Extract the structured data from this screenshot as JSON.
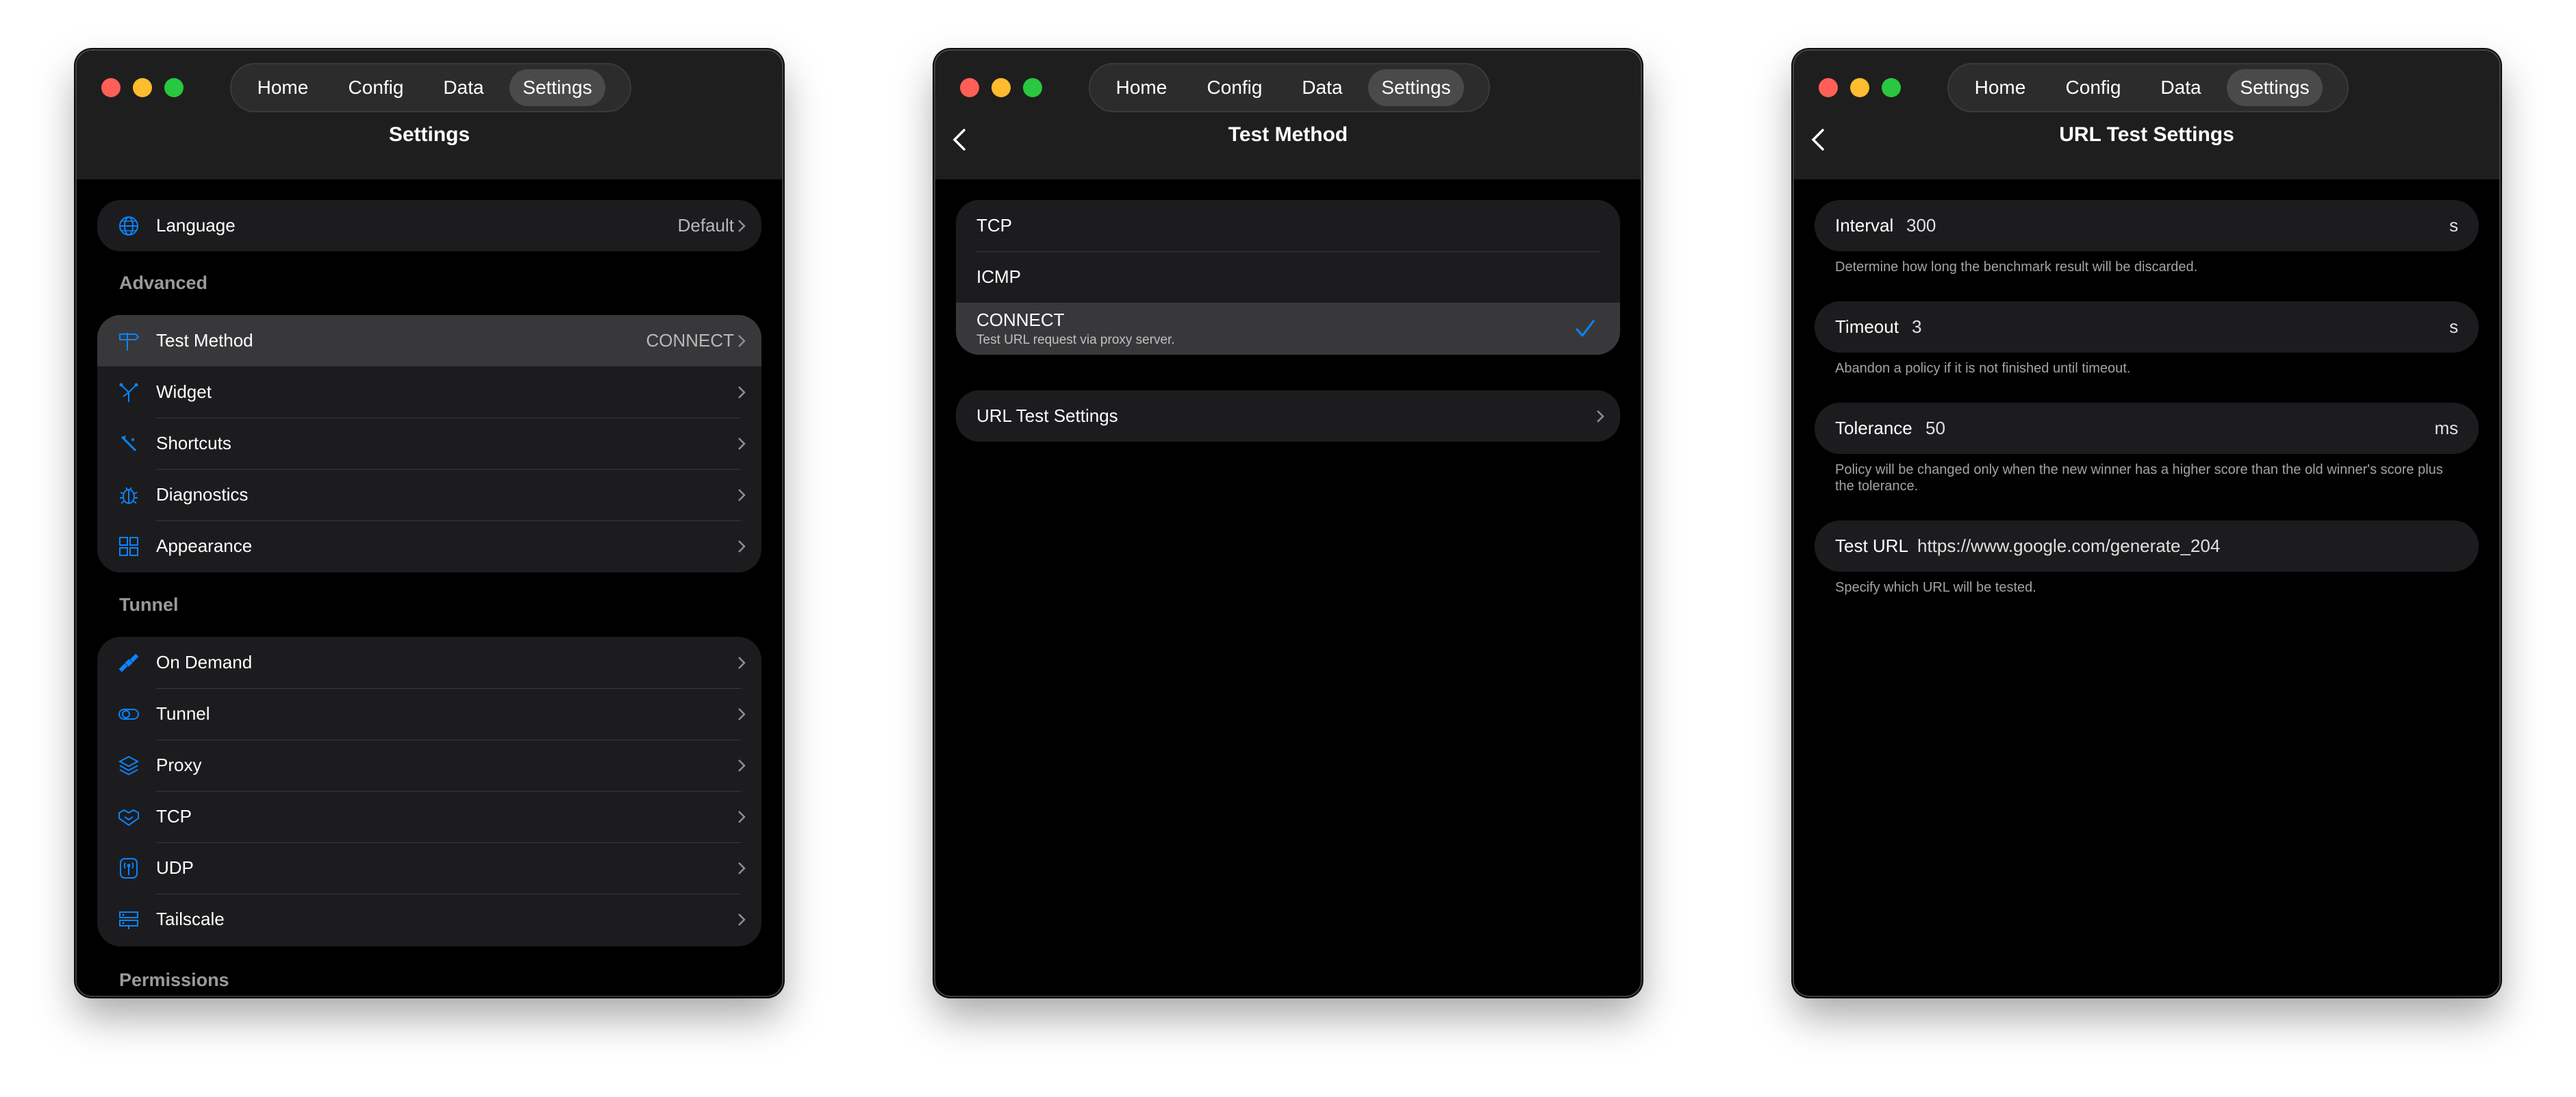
{
  "nav_tabs": [
    "Home",
    "Config",
    "Data",
    "Settings"
  ],
  "colors": {
    "accent": "#0a84ff",
    "row_bg": "#1c1c1e",
    "highlight": "#38383a"
  },
  "window1": {
    "title": "Settings",
    "language": {
      "label": "Language",
      "value": "Default"
    },
    "advanced_header": "Advanced",
    "advanced_items": [
      {
        "label": "Test Method",
        "value": "CONNECT",
        "icon": "signpost-icon"
      },
      {
        "label": "Widget",
        "value": "",
        "icon": "widget-icon"
      },
      {
        "label": "Shortcuts",
        "value": "",
        "icon": "shortcuts-icon"
      },
      {
        "label": "Diagnostics",
        "value": "",
        "icon": "ladybug-icon"
      },
      {
        "label": "Appearance",
        "value": "",
        "icon": "grid-icon"
      }
    ],
    "tunnel_header": "Tunnel",
    "tunnel_items": [
      {
        "label": "On Demand",
        "icon": "satellite-icon"
      },
      {
        "label": "Tunnel",
        "icon": "pill-icon"
      },
      {
        "label": "Proxy",
        "icon": "layers-icon"
      },
      {
        "label": "TCP",
        "icon": "handshake-icon"
      },
      {
        "label": "UDP",
        "icon": "antenna-icon"
      },
      {
        "label": "Tailscale",
        "icon": "server-rack-icon"
      }
    ],
    "permissions_header": "Permissions"
  },
  "window2": {
    "title": "Test Method",
    "methods": [
      {
        "label": "TCP",
        "subtitle": ""
      },
      {
        "label": "ICMP",
        "subtitle": ""
      },
      {
        "label": "CONNECT",
        "subtitle": "Test URL request via proxy server."
      }
    ],
    "selected_method": "CONNECT",
    "url_test_link": "URL Test Settings"
  },
  "window3": {
    "title": "URL Test Settings",
    "fields": [
      {
        "label": "Interval",
        "value": "300",
        "unit": "s",
        "hint": "Determine how long the benchmark result will be discarded."
      },
      {
        "label": "Timeout",
        "value": "3",
        "unit": "s",
        "hint": "Abandon a policy if it is not finished until timeout."
      },
      {
        "label": "Tolerance",
        "value": "50",
        "unit": "ms",
        "hint": "Policy will be changed only when the new winner has a higher score than the old winner's score plus the tolerance."
      },
      {
        "label": "Test URL",
        "value": "https://www.google.com/generate_204",
        "unit": "",
        "hint": "Specify which URL will be tested."
      }
    ]
  }
}
